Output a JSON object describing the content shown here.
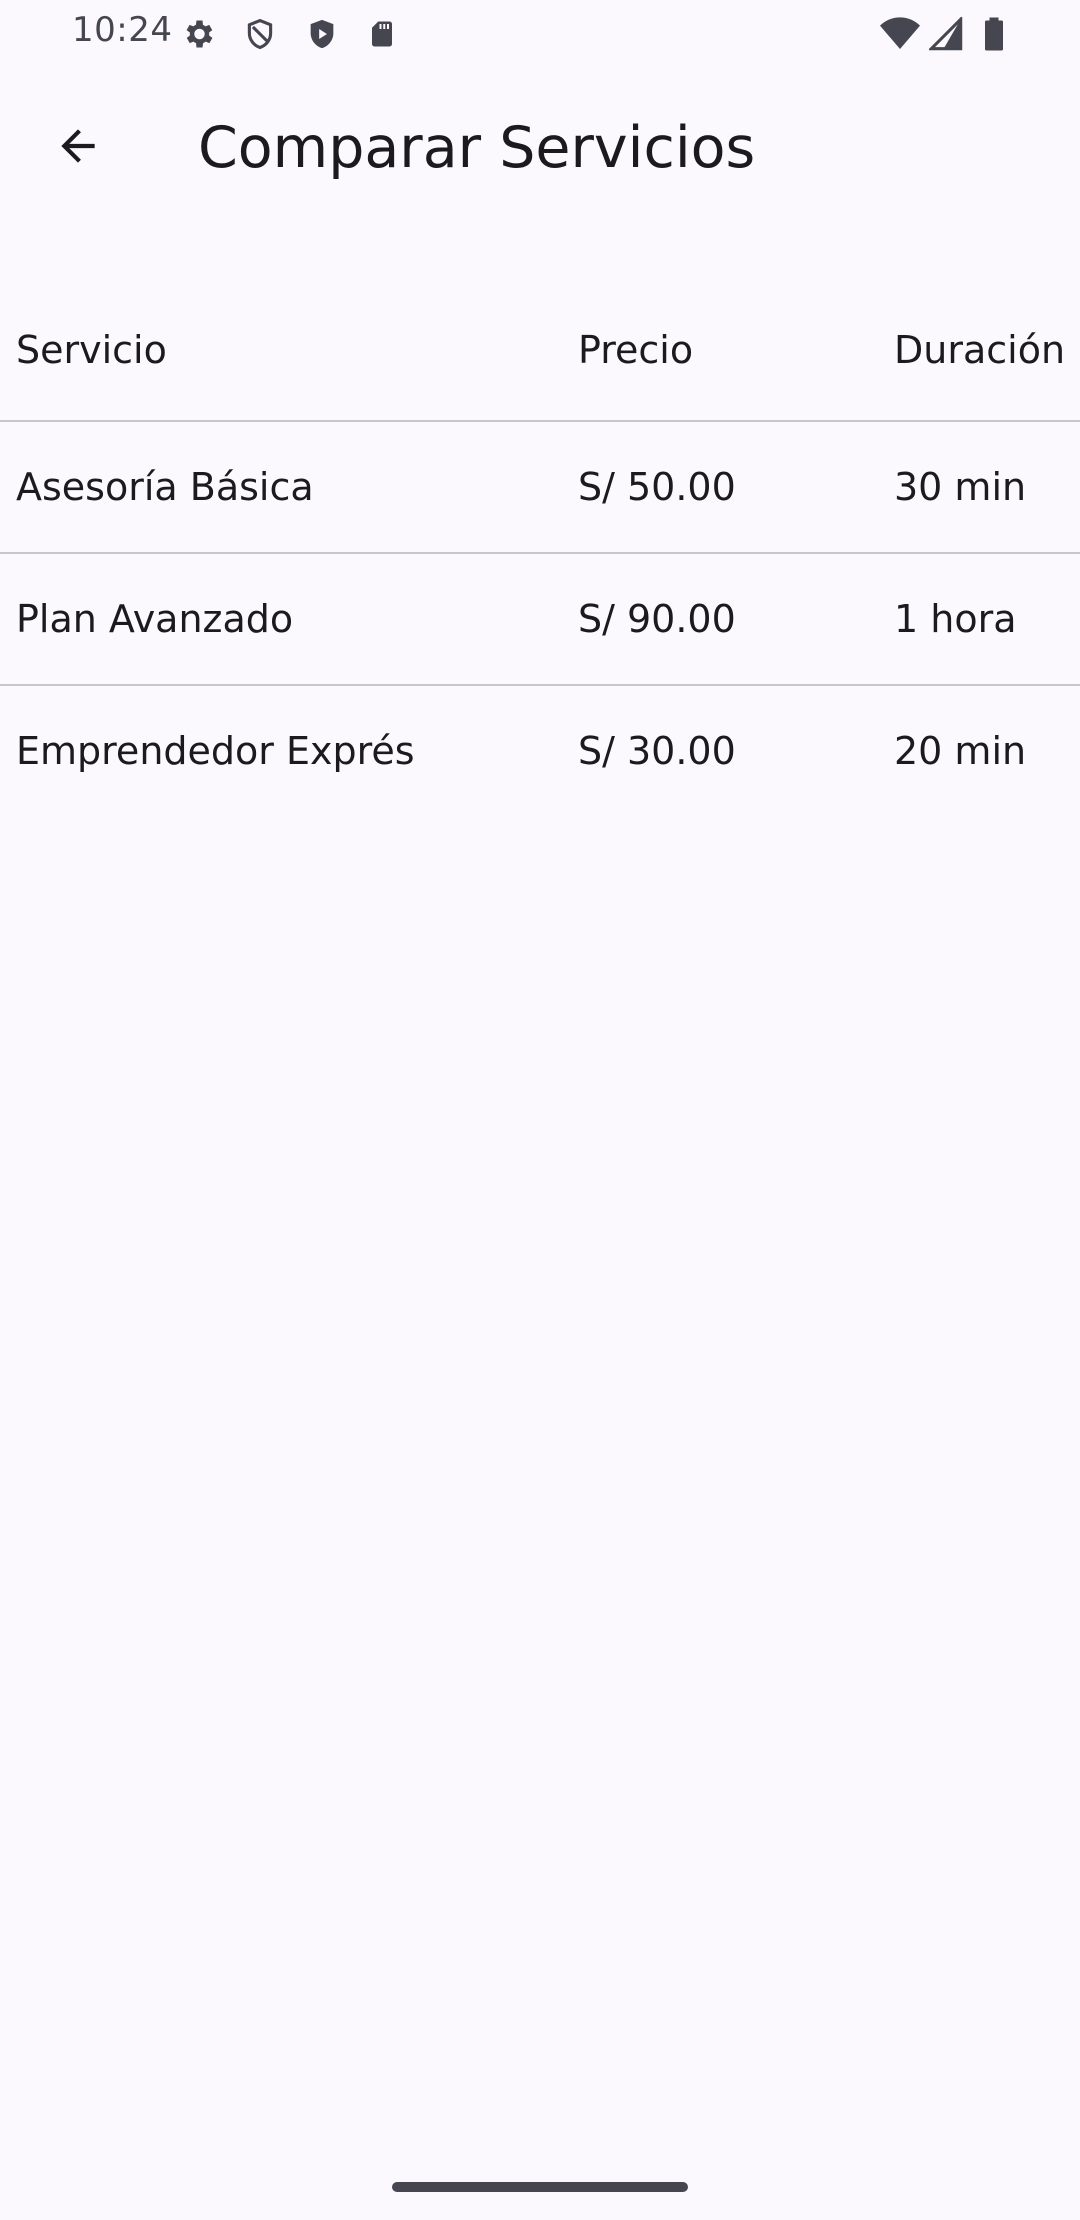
{
  "status_bar": {
    "time": "10:24",
    "icons_left": [
      "gear-icon",
      "shield-outline-icon",
      "shield-play-icon",
      "sd-card-icon"
    ],
    "icons_right": [
      "wifi-icon",
      "cellular-signal-icon",
      "battery-icon"
    ]
  },
  "app_bar": {
    "back_icon": "arrow-back-icon",
    "title": "Comparar Servicios"
  },
  "table": {
    "headers": {
      "servicio": "Servicio",
      "precio": "Precio",
      "duracion": "Duración"
    },
    "rows": [
      {
        "servicio": "Asesoría Básica",
        "precio": "S/ 50.00",
        "duracion": "30 min"
      },
      {
        "servicio": "Plan Avanzado",
        "precio": "S/ 90.00",
        "duracion": "1 hora"
      },
      {
        "servicio": "Emprendedor Exprés",
        "precio": "S/ 30.00",
        "duracion": "20 min"
      }
    ]
  },
  "colors": {
    "background": "#fbf8fe",
    "text": "#1b1b1f",
    "divider": "#c7c6ca",
    "status_icons": "#45464f"
  }
}
